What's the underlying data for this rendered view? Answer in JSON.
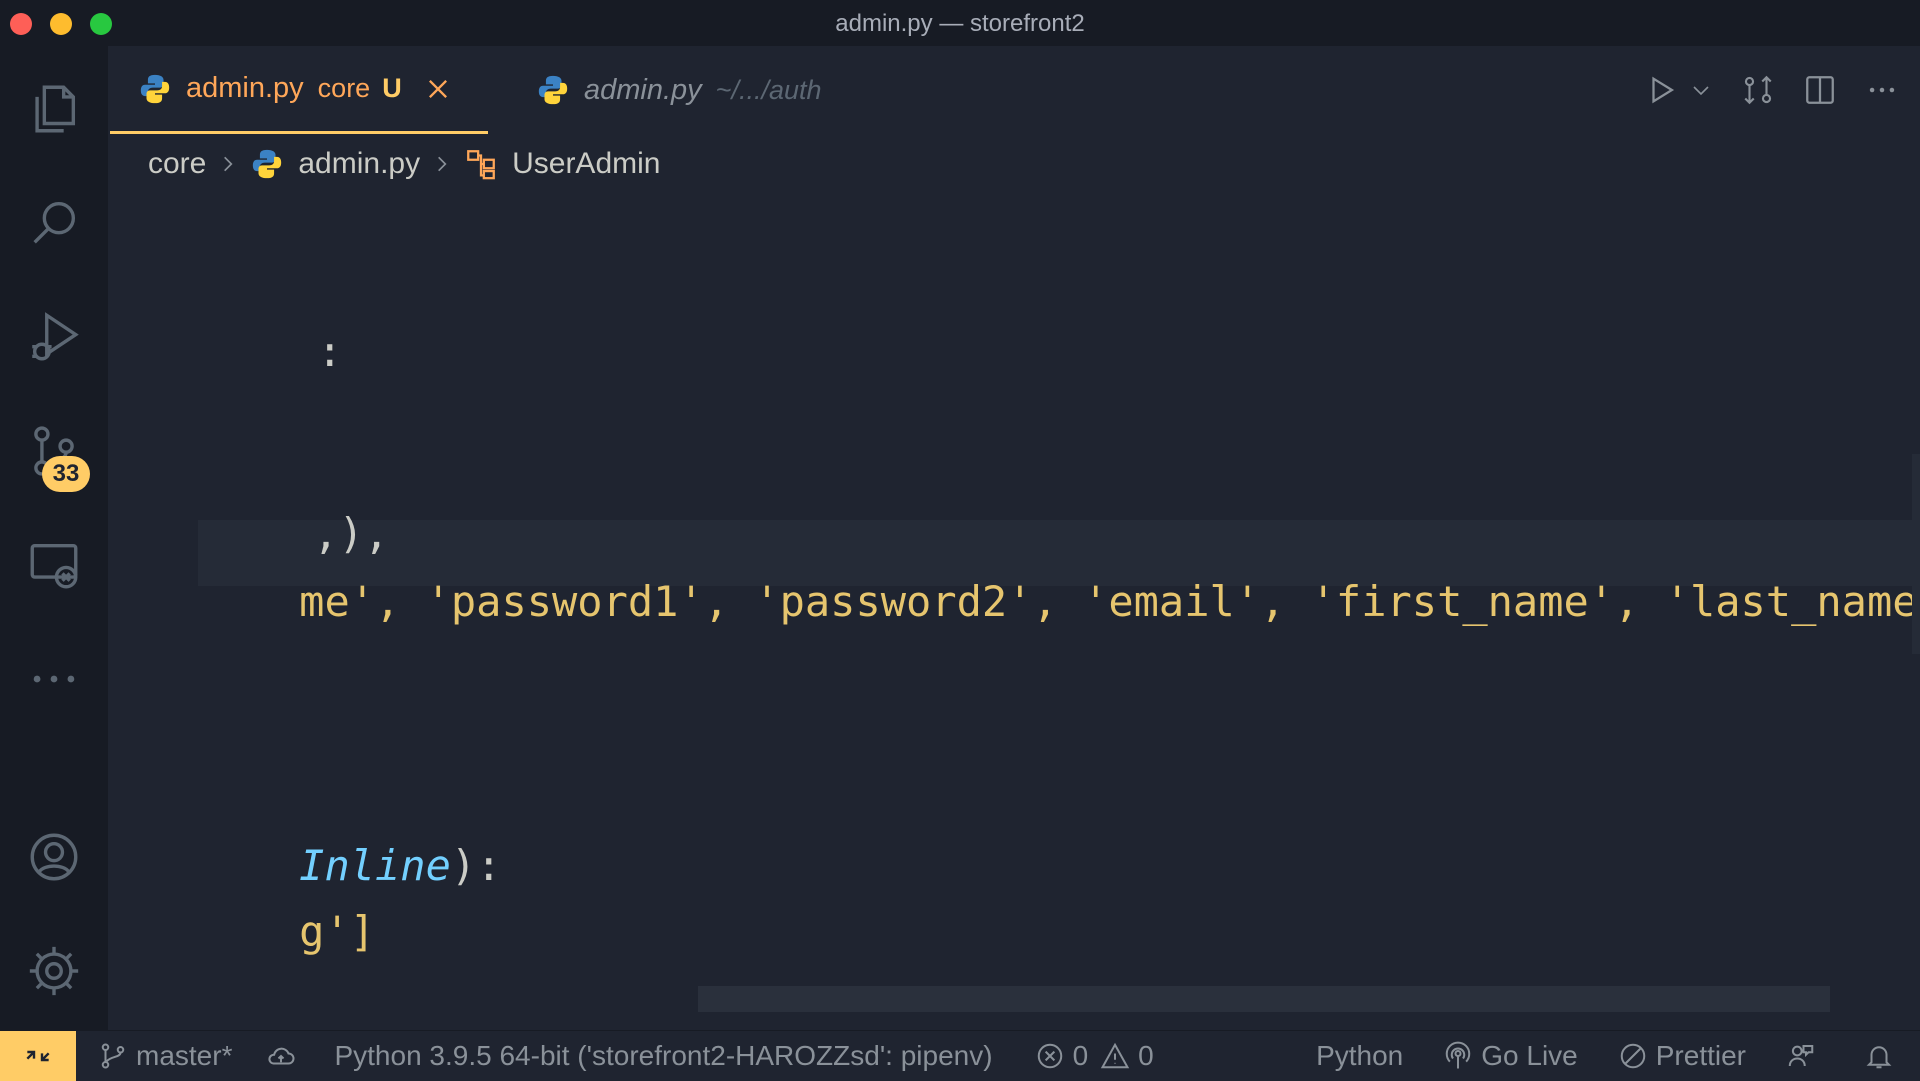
{
  "window": {
    "title": "admin.py — storefront2"
  },
  "activity_bar": {
    "source_control_badge": "33"
  },
  "tabs": [
    {
      "name": "admin.py",
      "description": "core",
      "status": "U"
    },
    {
      "name": "admin.py",
      "description": "~/.../auth"
    }
  ],
  "breadcrumb": {
    "folder": "core",
    "file": "admin.py",
    "symbol": "UserAdmin"
  },
  "code": {
    "line1": ":",
    "line2": ",),",
    "line3_parts": [
      "me', ",
      "'password1', ",
      "'password2', ",
      "'email', ",
      "'first_name', ",
      "'last_name'",
      ")"
    ],
    "line4_cls": "Inline",
    "line4_rest": "):",
    "line5": "g']"
  },
  "status_bar": {
    "branch": "master*",
    "interpreter": "Python 3.9.5 64-bit ('storefront2-HAROZZsd': pipenv)",
    "errors": "0",
    "warnings": "0",
    "language": "Python",
    "go_live": "Go Live",
    "prettier": "Prettier"
  },
  "colors": {
    "accent": "#ffcc66",
    "tab_active": "#ffa759",
    "string": "#bae67e",
    "class": "#73d0ff"
  },
  "icons": [
    "files-icon",
    "search-icon",
    "run-debug-icon",
    "source-control-icon",
    "remote-explorer-icon",
    "more-icon",
    "account-icon",
    "gear-icon",
    "python-file-icon",
    "close-icon",
    "run-icon",
    "chevron-down-icon",
    "compare-icon",
    "split-editor-icon",
    "ellipsis-icon",
    "class-symbol-icon",
    "branch-icon",
    "cloud-sync-icon",
    "error-icon",
    "warning-icon",
    "broadcast-icon",
    "prettier-icon",
    "feedback-icon",
    "bell-icon",
    "remote-icon"
  ]
}
